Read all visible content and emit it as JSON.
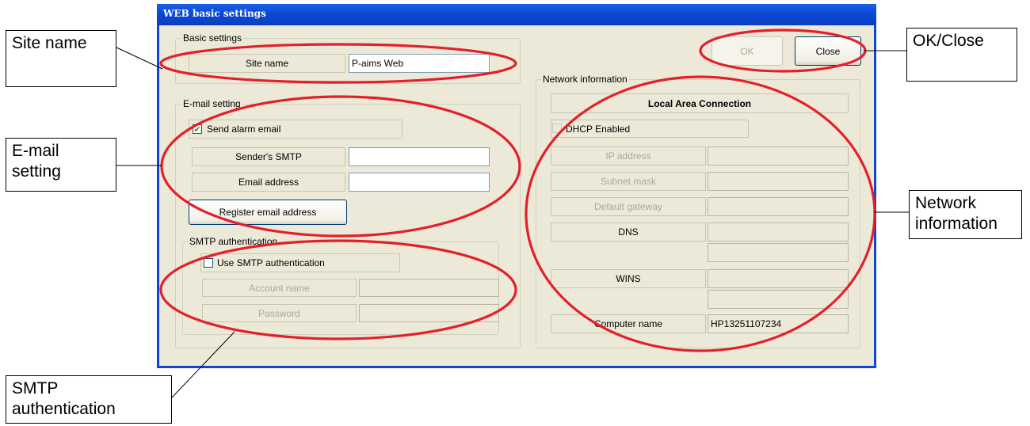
{
  "window": {
    "title": "WEB basic settings"
  },
  "buttons": {
    "ok": "OK",
    "close": "Close"
  },
  "basic_settings": {
    "legend": "Basic settings",
    "site_name_label": "Site name",
    "site_name_value": "P-aims Web"
  },
  "email_setting": {
    "legend": "E-mail setting",
    "send_alarm_label": "Send alarm email",
    "send_alarm_checked": "✔",
    "smtp_label": "Sender's SMTP",
    "smtp_value": "",
    "email_label": "Email address",
    "email_value": "",
    "register_button": "Register email address"
  },
  "smtp_auth": {
    "legend": "SMTP authentication",
    "use_label": "Use SMTP authentication",
    "account_label": "Account name",
    "account_value": "",
    "password_label": "Password",
    "password_value": ""
  },
  "network": {
    "legend": "Network information",
    "connection": "Local Area Connection",
    "dhcp_label": "DHCP Enabled",
    "ip_label": "IP address",
    "subnet_label": "Subnet mask",
    "gateway_label": "Default gateway",
    "dns_label": "DNS",
    "wins_label": "WINS",
    "computer_name_label": "Computer name",
    "computer_name_value": "HP13251107234"
  },
  "callouts": {
    "site_name": "Site name",
    "email_line1": "E-mail",
    "email_line2": "setting",
    "smtp_line1": "SMTP",
    "smtp_line2": "authentication",
    "ok_close": "OK/Close",
    "network_line1": "Network",
    "network_line2": "information"
  },
  "colors": {
    "annotation": "#e3202a",
    "window_frame": "#0a46d8",
    "dialog_bg": "#ece9d8"
  }
}
